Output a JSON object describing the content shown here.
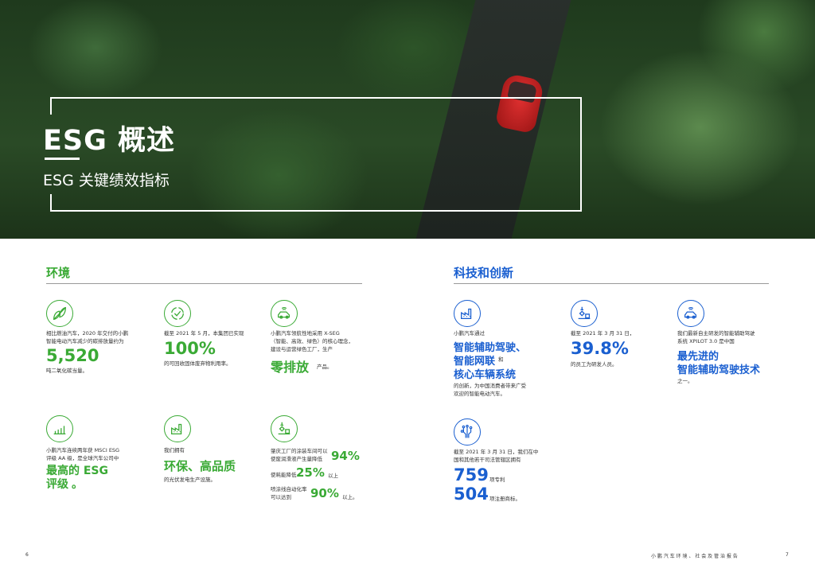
{
  "header": {
    "title": "ESG 概述",
    "subtitle": "ESG 关键绩效指标"
  },
  "colors": {
    "environment": "#3aaa35",
    "technology": "#1a5fd0"
  },
  "environment": {
    "heading": "环境",
    "items": [
      {
        "icon": "leaf-icon",
        "line1": "相比燃油汽车，2020 年交付的小鹏",
        "line2": "智能电动汽车减少的碳排放量约为",
        "value": "5,520",
        "after": "吨二氧化碳当量。"
      },
      {
        "icon": "recycle-check-icon",
        "line1": "截至 2021 年 5 月，本集团已实现",
        "value": "100%",
        "after": "的可回收固体废弃物利用率。"
      },
      {
        "icon": "connected-car-icon",
        "line1": "小鹏汽车领航性地采用 X-SEG",
        "line2": "（智能、高效、绿色）的核心理念，",
        "line3": "建设与运营绿色工厂，生产",
        "value": "零排放",
        "after": "产品。"
      },
      {
        "icon": "bar-chart-icon",
        "line1": "小鹏汽车连续两年获 MSCI ESG",
        "line2": "评级 AA 级，是全球汽车公司中",
        "value1": "最高的 ESG",
        "value2": "评级",
        "after": "。"
      },
      {
        "icon": "factory-icon",
        "line1": "我们拥有",
        "value": "环保、高品质",
        "after": "的光伏发电生产设施。"
      },
      {
        "icon": "robot-arm-icon",
        "a1": "肇庆工厂的涂装车间可以",
        "a2": "使废润滑液产生量降低",
        "v1": "94%",
        "b1": "使耗能降低",
        "v2": "25%",
        "b2": "以上",
        "c1": "喷涂线自动化率",
        "c2": "可以达到",
        "v3": "90%",
        "c3": "以上。"
      }
    ]
  },
  "technology": {
    "heading": "科技和创新",
    "items": [
      {
        "icon": "factory-icon",
        "line1": "小鹏汽车通过",
        "h1": "智能辅助驾驶、",
        "h2": "智能网联",
        "h2small": "和",
        "h3": "核心车辆系统",
        "after1": "的创新，为中国消费者带来广受",
        "after2": "欢迎的智能电动汽车。"
      },
      {
        "icon": "robot-arm-icon",
        "line1": "截至 2021 年 3 月 31 日，",
        "value": "39.8%",
        "after": "的员工为研发人员。"
      },
      {
        "icon": "connected-car-icon",
        "line1": "我们最新自主研发的智能辅助驾驶",
        "line2": "系统 XPILOT 3.0 是中国",
        "h1": "最先进的",
        "h2": "智能辅助驾驶技术",
        "after": "之一。"
      },
      {
        "icon": "circuit-icon",
        "line1": "截至 2021 年 3 月 31 日，我们在中",
        "line2": "国和其他若干司法管辖区拥有",
        "v1": "759",
        "l1": "项专利",
        "v2": "504",
        "l2": "项注册商标。"
      }
    ]
  },
  "footer": {
    "left_page": "6",
    "report": "小 鹏 汽 车 环 境 、 社 会 及 管 治 报 告",
    "right_page": "7"
  }
}
